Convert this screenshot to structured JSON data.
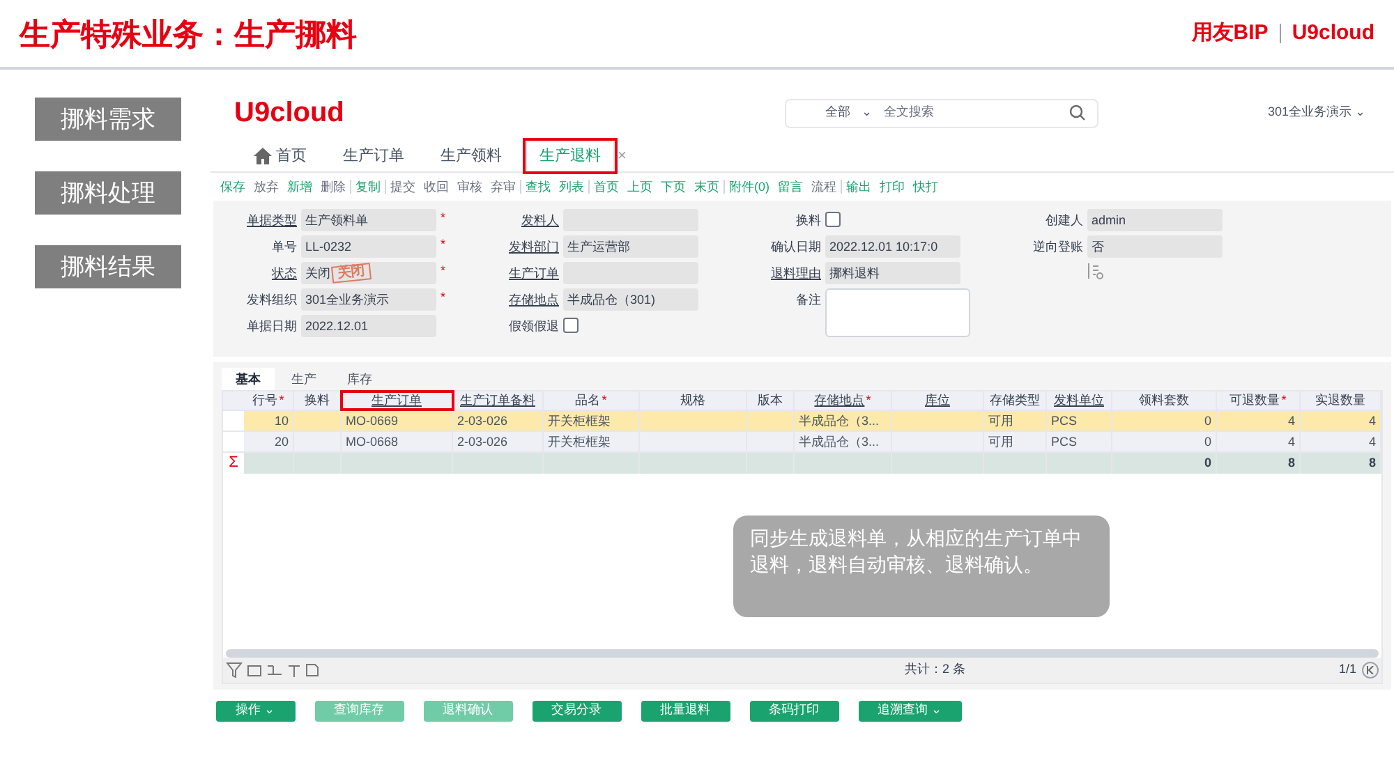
{
  "slide": {
    "title": "生产特殊业务：生产挪料",
    "brand": "用友BIP",
    "brand_product": "U9cloud"
  },
  "slide_menu": [
    {
      "label": "挪料需求"
    },
    {
      "label": "挪料处理"
    },
    {
      "label": "挪料结果"
    }
  ],
  "app": {
    "logo": "U9cloud",
    "search": {
      "scope": "全部",
      "scope_caret": "⌄",
      "placeholder": "全文搜索"
    },
    "user": "301全业务演示",
    "user_caret": "⌄"
  },
  "tabs": [
    {
      "label": "首页",
      "kind": "home",
      "selected": false,
      "highlighted": false
    },
    {
      "label": "生产订单",
      "kind": "page",
      "selected": false,
      "highlighted": false
    },
    {
      "label": "生产领料",
      "kind": "page",
      "selected": false,
      "highlighted": false
    },
    {
      "label": "生产退料",
      "kind": "page",
      "selected": true,
      "highlighted": true,
      "close": "×"
    }
  ],
  "toolbar": [
    {
      "label": "保存",
      "disabled": false,
      "separator_after": false
    },
    {
      "label": "放弃",
      "disabled": true,
      "separator_after": false
    },
    {
      "label": "新增",
      "disabled": false,
      "separator_after": false
    },
    {
      "label": "删除",
      "disabled": true,
      "separator_after": true
    },
    {
      "label": "复制",
      "disabled": false,
      "separator_after": true
    },
    {
      "label": "提交",
      "disabled": true,
      "separator_after": false
    },
    {
      "label": "收回",
      "disabled": true,
      "separator_after": false
    },
    {
      "label": "审核",
      "disabled": true,
      "separator_after": false
    },
    {
      "label": "弃审",
      "disabled": true,
      "separator_after": true
    },
    {
      "label": "查找",
      "disabled": false,
      "separator_after": false
    },
    {
      "label": "列表",
      "disabled": false,
      "separator_after": true
    },
    {
      "label": "首页",
      "disabled": false,
      "separator_after": false
    },
    {
      "label": "上页",
      "disabled": false,
      "separator_after": false
    },
    {
      "label": "下页",
      "disabled": false,
      "separator_after": false
    },
    {
      "label": "末页",
      "disabled": false,
      "separator_after": true
    },
    {
      "label": "附件(0)",
      "disabled": false,
      "separator_after": false
    },
    {
      "label": "留言",
      "disabled": false,
      "separator_after": false
    },
    {
      "label": "流程",
      "disabled": true,
      "separator_after": true
    },
    {
      "label": "输出",
      "disabled": false,
      "separator_after": false
    },
    {
      "label": "打印",
      "disabled": false,
      "separator_after": false
    },
    {
      "label": "快打",
      "disabled": false,
      "separator_after": false
    }
  ],
  "form_columns": [
    [
      {
        "label": "单据类型",
        "kind": "select",
        "value": "生产领料单",
        "required_mark": "*",
        "link": true
      },
      {
        "label": "单号",
        "kind": "text",
        "value": "LL-0232",
        "required_mark": "*",
        "link": false
      },
      {
        "label": "状态",
        "kind": "select",
        "value": "关闭",
        "required_mark": "*",
        "link": true,
        "stamp": "关闭"
      },
      {
        "label": "发料组织",
        "kind": "select",
        "value": "301全业务演示",
        "required_mark": "*",
        "link": false
      },
      {
        "label": "单据日期",
        "kind": "date",
        "value": "2022.12.01",
        "link": false
      }
    ],
    [
      {
        "label": "发料人",
        "kind": "select",
        "link": true
      },
      {
        "label": "发料部门",
        "kind": "select",
        "value": "生产运营部",
        "link": true
      },
      {
        "label": "生产订单",
        "kind": "select",
        "link": true
      },
      {
        "label": "存储地点",
        "kind": "select",
        "value": "半成品仓（301)",
        "link": true
      },
      {
        "label": "假领假退",
        "kind": "checkbox",
        "checked": false,
        "link": false
      }
    ],
    [
      {
        "label": "换料",
        "kind": "checkbox",
        "checked": false,
        "link": false
      },
      {
        "label": "确认日期",
        "kind": "date",
        "value": "2022.12.01 10:17:0",
        "link": false
      },
      {
        "label": "退料理由",
        "kind": "select",
        "value": "挪料退料",
        "link": true
      },
      {
        "label": "备注",
        "kind": "textarea",
        "link": false
      }
    ],
    [
      {
        "label": "创建人",
        "kind": "text",
        "value": "admin",
        "link": false
      },
      {
        "label": "逆向登账",
        "kind": "select",
        "value": "否",
        "link": false
      },
      {
        "kind": "tool"
      }
    ]
  ],
  "detail_tabs": [
    {
      "label": "基本",
      "selected": true
    },
    {
      "label": "生产",
      "selected": false
    },
    {
      "label": "库存",
      "selected": false
    }
  ],
  "grid": {
    "columns": [
      {
        "label": "行号",
        "required_mark": "*",
        "link": false,
        "highlighted": false
      },
      {
        "label": "换料",
        "link": false,
        "highlighted": false
      },
      {
        "label": "生产订单",
        "link": true,
        "highlighted": true
      },
      {
        "label": "生产订单备料",
        "link": true,
        "highlighted": false
      },
      {
        "label": "品名",
        "required_mark": "*",
        "link": false,
        "highlighted": false
      },
      {
        "label": "规格",
        "link": false,
        "highlighted": false
      },
      {
        "label": "版本",
        "link": false,
        "highlighted": false
      },
      {
        "label": "存储地点",
        "required_mark": "*",
        "link": true,
        "highlighted": false
      },
      {
        "label": "库位",
        "link": true,
        "highlighted": false
      },
      {
        "label": "存储类型",
        "link": false,
        "highlighted": false
      },
      {
        "label": "发料单位",
        "link": true,
        "highlighted": false
      },
      {
        "label": "领料套数",
        "link": false,
        "highlighted": false
      },
      {
        "label": "可退数量",
        "required_mark": "*",
        "link": false,
        "highlighted": false
      },
      {
        "label": "实退数量",
        "link": false,
        "highlighted": false
      }
    ],
    "rows": [
      {
        "selected": true,
        "cells": [
          "10",
          null,
          "MO-0669",
          "2-03-026",
          "开关柜框架",
          null,
          null,
          "半成品仓（3...",
          null,
          "可用",
          "PCS",
          "0",
          "4",
          "4"
        ]
      },
      {
        "selected": false,
        "cells": [
          "20",
          null,
          "MO-0668",
          "2-03-026",
          "开关柜框架",
          null,
          null,
          "半成品仓（3...",
          null,
          "可用",
          "PCS",
          "0",
          "4",
          "4"
        ]
      }
    ],
    "sum_symbol": "Σ",
    "sum_row": [
      "0",
      "8",
      "8"
    ],
    "total": "共计：2 条",
    "pages": "1/1"
  },
  "callout": "同步生成退料单，从相应的生产订单中退料，退料自动审核、退料确认。",
  "actions": [
    {
      "label": "操作",
      "caret": "⌄",
      "disabled": false
    },
    {
      "label": "查询库存",
      "disabled": true
    },
    {
      "label": "退料确认",
      "disabled": true
    },
    {
      "label": "交易分录",
      "disabled": false
    },
    {
      "label": "批量退料",
      "disabled": false
    },
    {
      "label": "条码打印",
      "disabled": false
    },
    {
      "label": "追溯查询",
      "caret": "⌄",
      "disabled": false
    }
  ]
}
